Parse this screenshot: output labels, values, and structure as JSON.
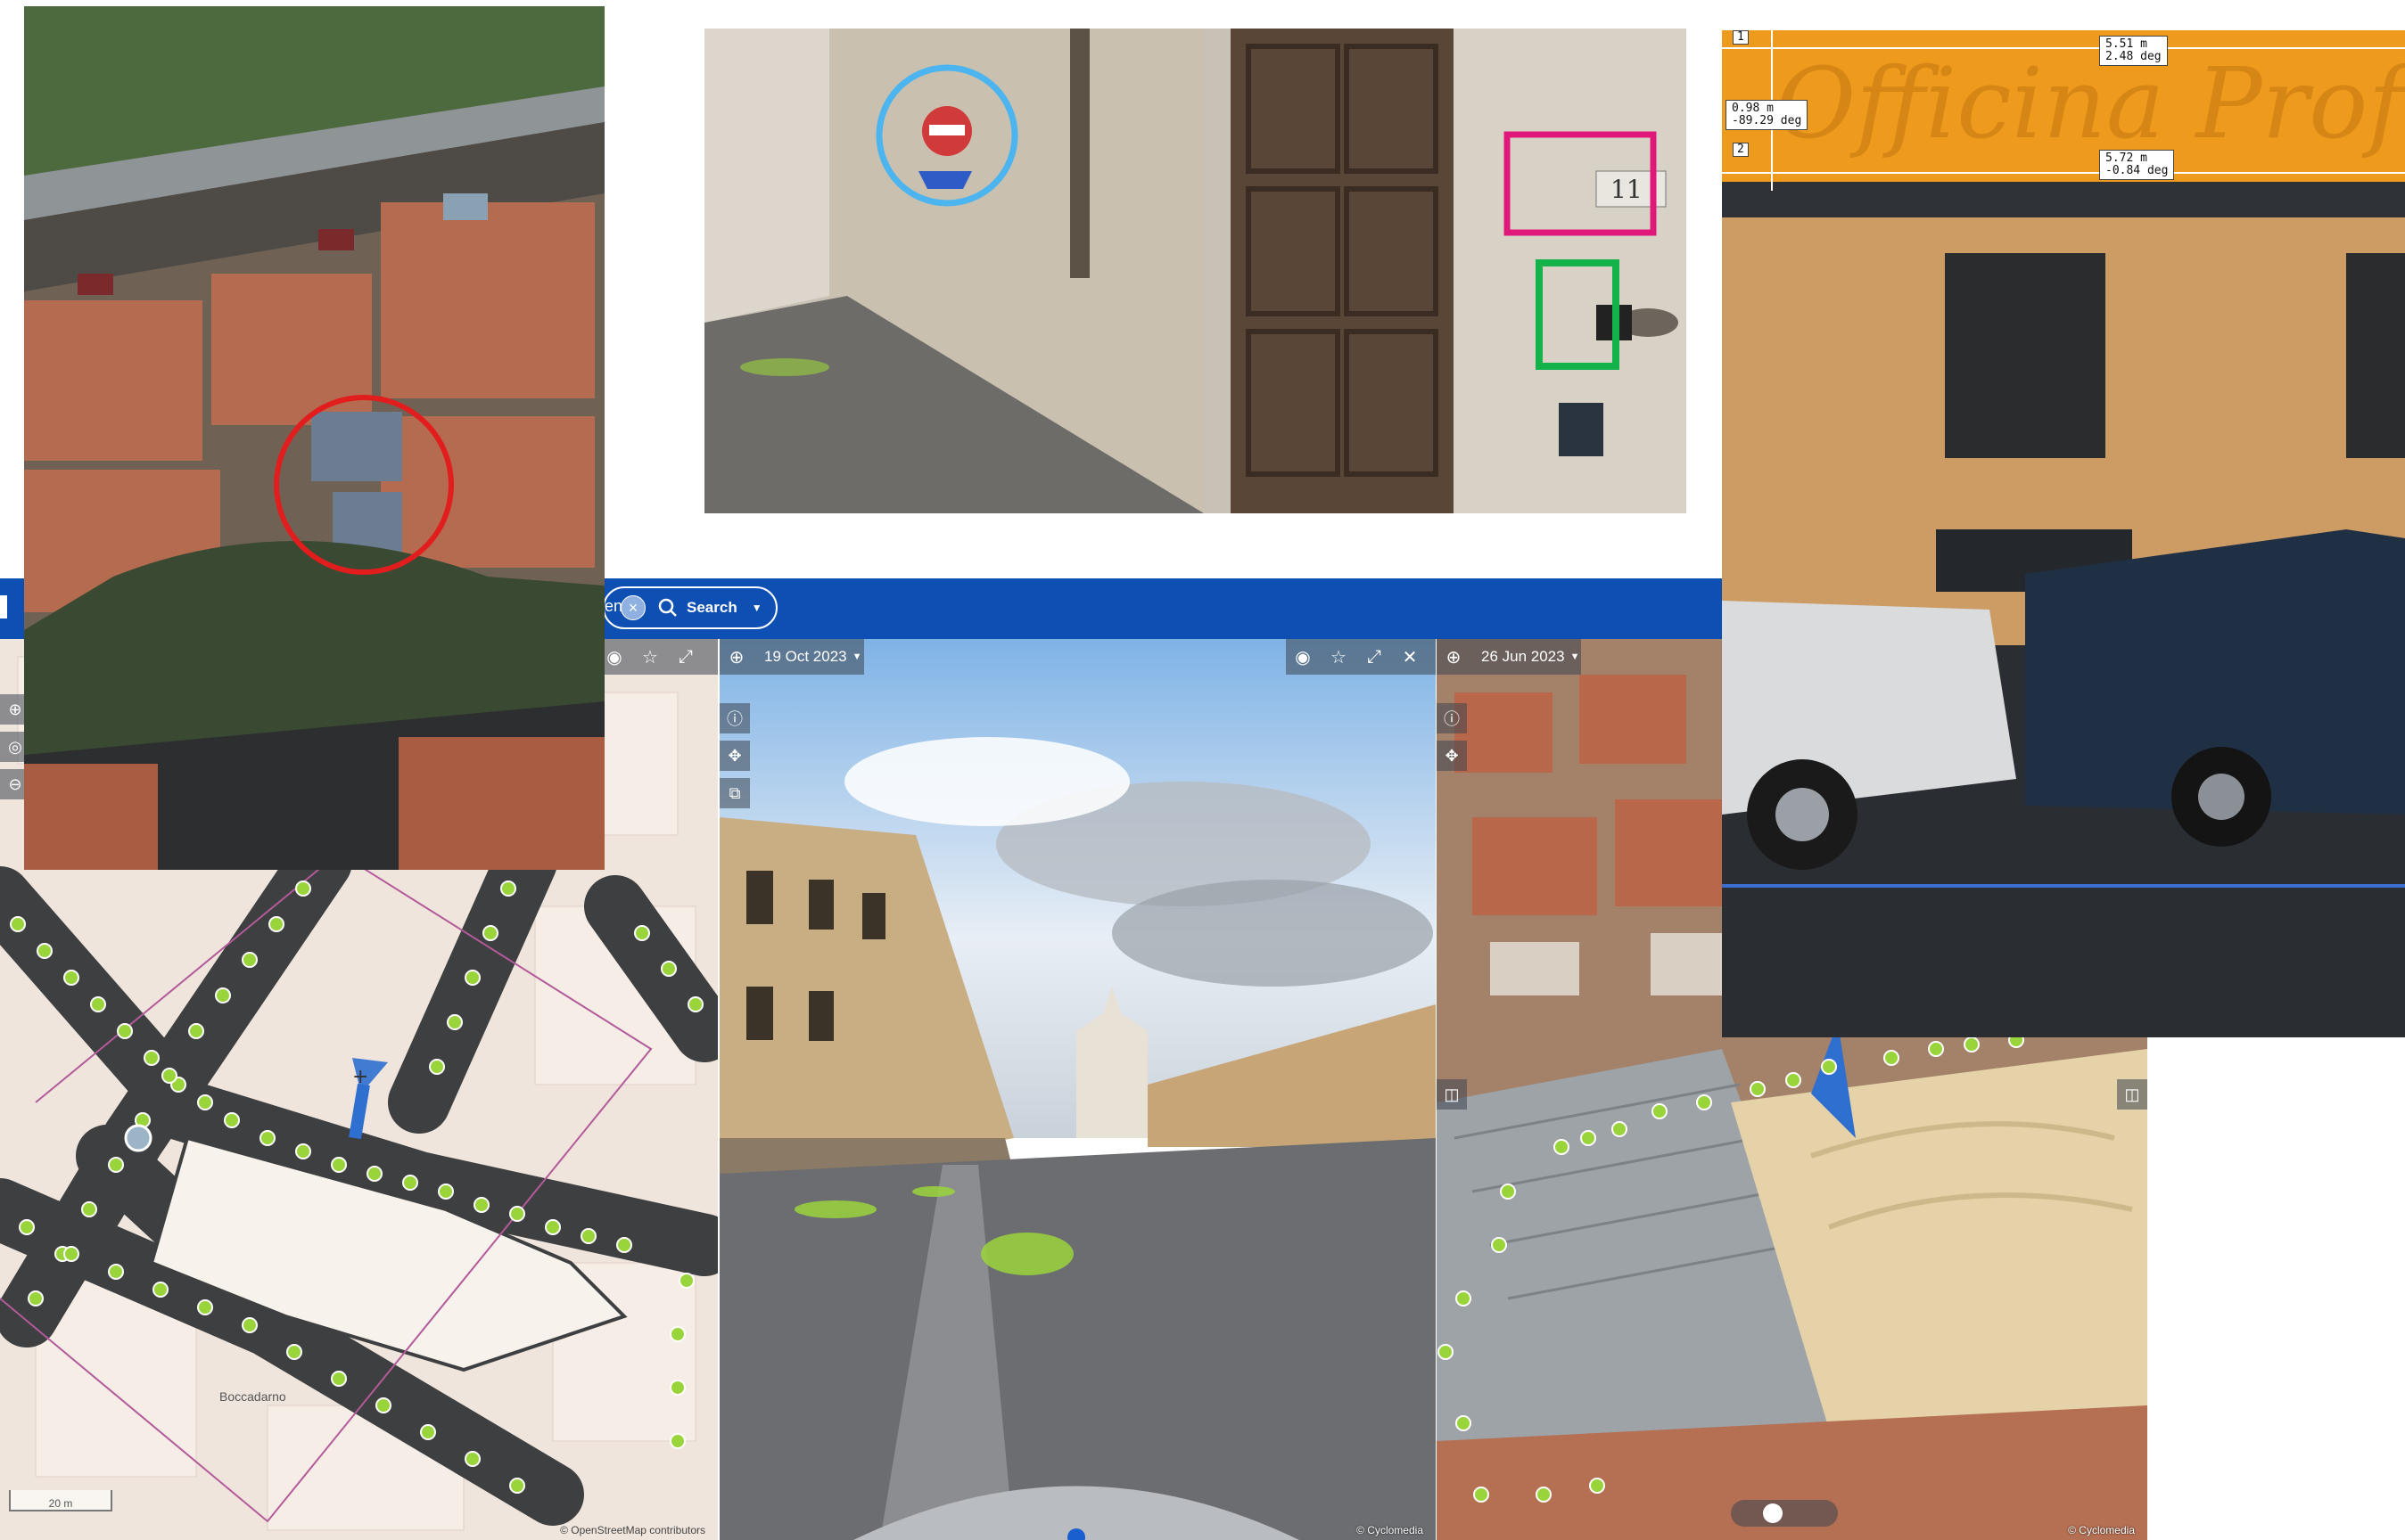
{
  "app_bar": {
    "truncated_text": "ren",
    "search_label": "Search",
    "clear_icon": "close-circle-icon",
    "search_icon": "search-icon",
    "dropdown_icon": "caret-down-icon"
  },
  "viewer_streetview": {
    "date_label": "19 Oct 2023",
    "credit": "© Cyclomedia",
    "toolbar_icons": [
      "eye-icon",
      "star-icon",
      "expand-icon",
      "close-icon"
    ],
    "side_icons": [
      "info-icon",
      "crosshair-icon",
      "measure-icon"
    ]
  },
  "viewer_oblique": {
    "date_label": "26 Jun 2023",
    "credit": "© Cyclomedia"
  },
  "map_view": {
    "credit": "© OpenStreetMap contributors",
    "scale_label": "20 m",
    "place_label": "Boccadarno",
    "toolbar_icons": [
      "eye-icon",
      "star-icon",
      "expand-icon"
    ]
  },
  "measurement_panel": {
    "label_top_right": [
      "5.51 m",
      "2.48 deg"
    ],
    "label_left": [
      "0.98 m",
      "-89.29 deg"
    ],
    "label_mid": [
      "5.72 m",
      "-0.84 deg"
    ],
    "point_labels": [
      "1",
      "2"
    ],
    "watermark": "Officina Profu"
  },
  "colors": {
    "app_bar": "#0e4fb3",
    "marker_green": "#9ad43b",
    "highlight_red": "#e11d1d",
    "highlight_blue": "#4cb4ef",
    "highlight_magenta": "#e0187a",
    "highlight_green": "#14b24a",
    "measure_orange": "#f29a14"
  }
}
